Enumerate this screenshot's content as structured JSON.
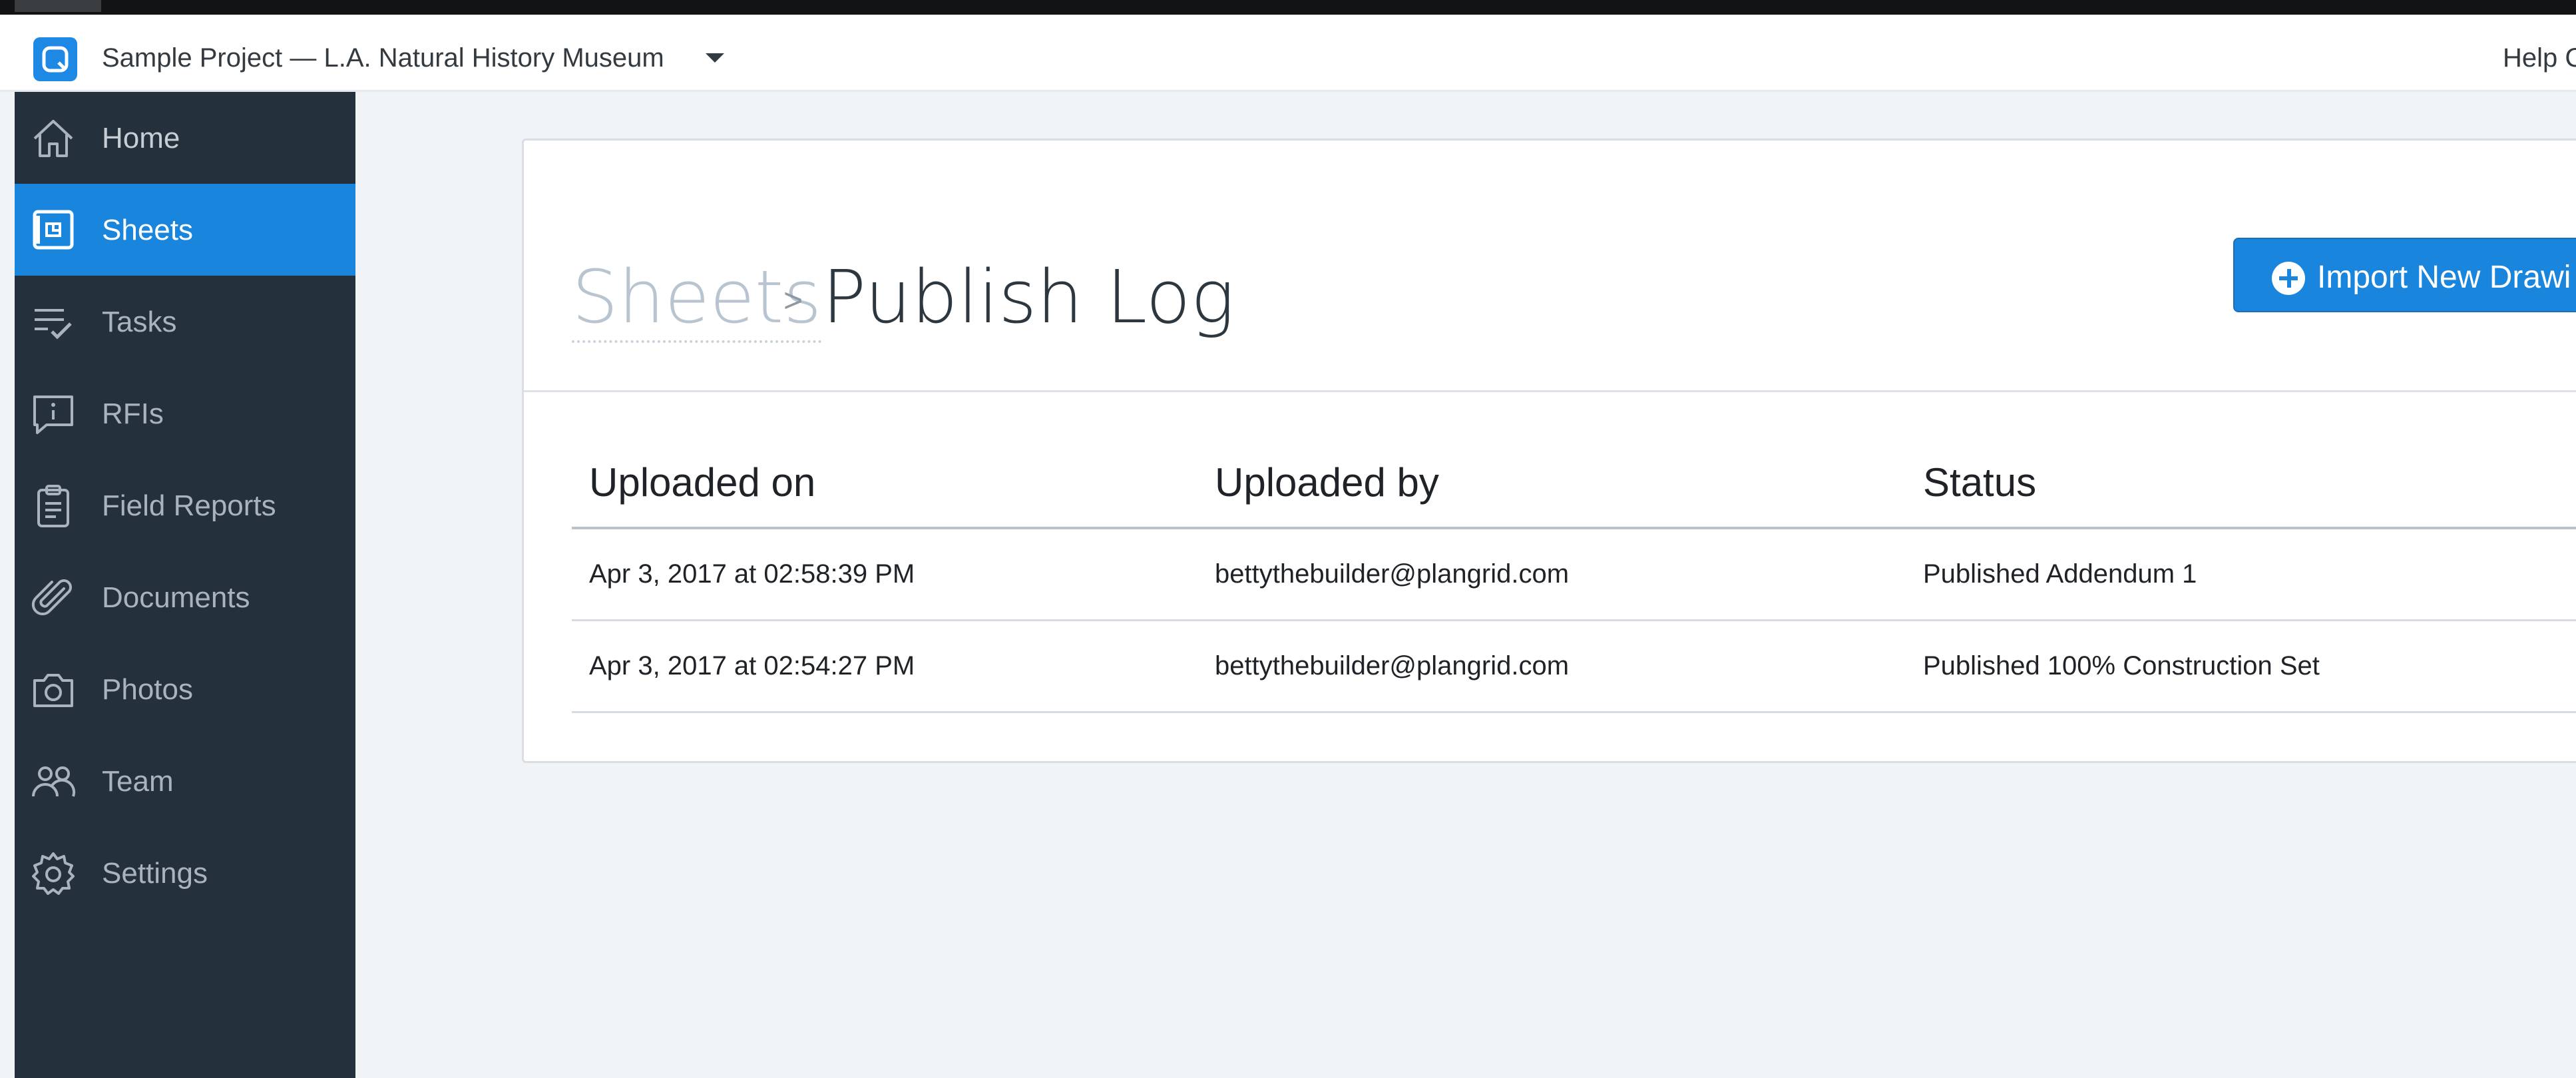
{
  "header": {
    "project_title": "Sample Project — L.A. Natural History Museum",
    "help_label": "Help C"
  },
  "sidebar": {
    "items": [
      {
        "label": "Home",
        "icon": "home-icon"
      },
      {
        "label": "Sheets",
        "icon": "sheets-icon",
        "active": true
      },
      {
        "label": "Tasks",
        "icon": "tasks-icon"
      },
      {
        "label": "RFIs",
        "icon": "rfi-icon"
      },
      {
        "label": "Field Reports",
        "icon": "clipboard-icon"
      },
      {
        "label": "Documents",
        "icon": "paperclip-icon"
      },
      {
        "label": "Photos",
        "icon": "camera-icon"
      },
      {
        "label": "Team",
        "icon": "team-icon"
      },
      {
        "label": "Settings",
        "icon": "gear-icon"
      }
    ]
  },
  "main": {
    "breadcrumb_parent": "Sheets",
    "breadcrumb_separator": ">",
    "page_title": "Publish Log",
    "import_button_label": "Import New Drawi",
    "table": {
      "columns": [
        "Uploaded on",
        "Uploaded by",
        "Status"
      ],
      "rows": [
        [
          "Apr 3, 2017 at 02:58:39 PM",
          "bettythebuilder@plangrid.com",
          "Published Addendum 1"
        ],
        [
          "Apr 3, 2017 at 02:54:27 PM",
          "bettythebuilder@plangrid.com",
          "Published 100% Construction Set"
        ]
      ]
    }
  },
  "colors": {
    "sidebar_bg": "#24313d",
    "accent": "#1a85dd",
    "page_bg": "#f0f4f7"
  }
}
